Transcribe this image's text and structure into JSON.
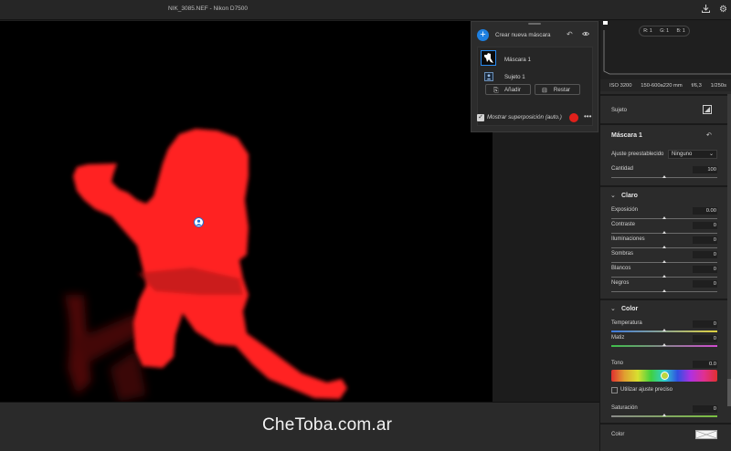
{
  "window": {
    "title": "NIK_3085.NEF - Nikon D7500"
  },
  "icons": {
    "export": "export-icon",
    "settings": "gear-icon"
  },
  "watermark": "CheToba.com.ar",
  "masks_panel": {
    "create_label": "Crear nueva máscara",
    "items": [
      {
        "label": "Máscara 1"
      },
      {
        "label": "Sujeto 1"
      }
    ],
    "add_label": "Añadir",
    "subtract_label": "Restar",
    "overlay_label": "Mostrar superposición (auto.)",
    "overlay_checked": true,
    "overlay_color": "#e0201b"
  },
  "histogram": {
    "r": "R: 1",
    "g": "G: 1",
    "b": "B: 1"
  },
  "camera_info": {
    "iso": "ISO 3200",
    "lens": "150-600a220 mm",
    "aperture": "f/6,3",
    "shutter": "1/250s"
  },
  "panel": {
    "subject_label": "Sujeto",
    "mask_title": "Máscara 1",
    "preset_label": "Ajuste preestablecido",
    "preset_value": "Ninguno",
    "amount_label": "Cantidad",
    "amount_value": "100",
    "light": {
      "title": "Claro",
      "rows": [
        {
          "label": "Exposición",
          "value": "0.00"
        },
        {
          "label": "Contraste",
          "value": "0"
        },
        {
          "label": "Iluminaciones",
          "value": "0"
        },
        {
          "label": "Sombras",
          "value": "0"
        },
        {
          "label": "Blancos",
          "value": "0"
        },
        {
          "label": "Negros",
          "value": "0"
        }
      ]
    },
    "color": {
      "title": "Color",
      "temperature_label": "Temperatura",
      "temperature_value": "0",
      "tint_label": "Matiz",
      "tint_value": "0",
      "hue_label": "Tono",
      "hue_value": "0.0",
      "fine_label": "Utilizar ajuste preciso",
      "saturation_label": "Saturación",
      "saturation_value": "0",
      "color_label": "Color"
    }
  },
  "colors": {
    "accent": "#1d7fe0",
    "mask_red": "#ff1e1e"
  }
}
